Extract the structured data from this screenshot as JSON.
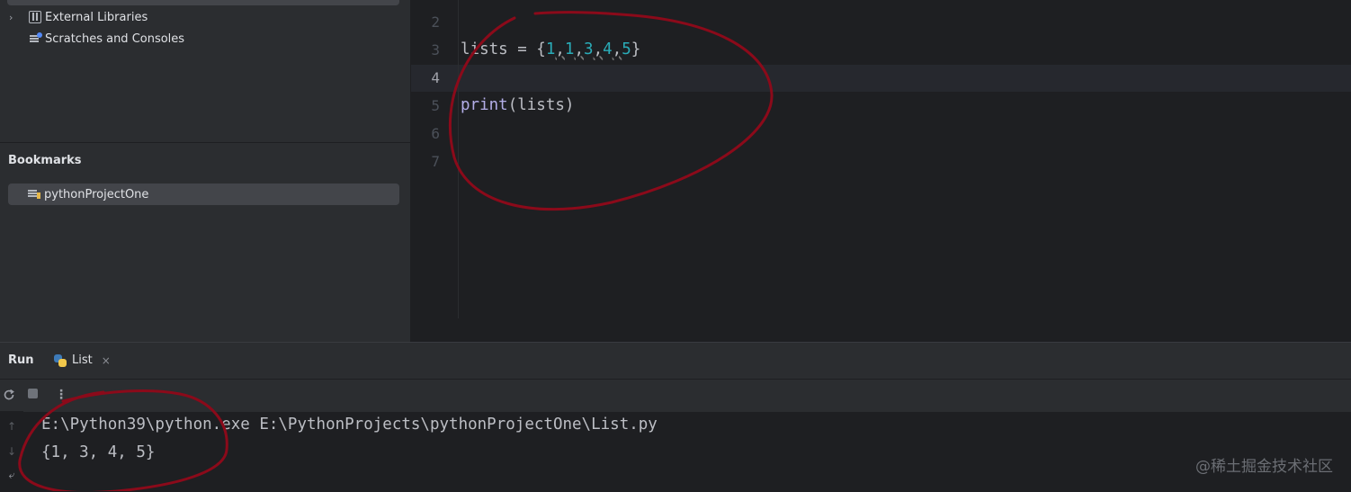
{
  "project_tree": {
    "items": [
      {
        "label": "External Libraries",
        "icon": "library-icon"
      },
      {
        "label": "Scratches and Consoles",
        "icon": "scratches-icon"
      }
    ]
  },
  "bookmarks": {
    "title": "Bookmarks",
    "items": [
      {
        "label": "pythonProjectOne"
      }
    ]
  },
  "editor": {
    "line_numbers": [
      "2",
      "3",
      "4",
      "5",
      "6",
      "7"
    ],
    "active_line": "4",
    "code_lines": {
      "line3_prefix": "lists = {",
      "line3_values": [
        "1",
        "1",
        "3",
        "4",
        "5"
      ],
      "line3_suffix": "}",
      "line5_fn": "print",
      "line5_args": "(lists)"
    }
  },
  "run_panel": {
    "title": "Run",
    "tab_label": "List",
    "tab_close": "×",
    "toolbar_more": "⋮",
    "console": {
      "command": "E:\\Python39\\python.exe E:\\PythonProjects\\pythonProjectOne\\List.py",
      "output": "{1, 3, 4, 5}"
    }
  },
  "watermark": "@稀土掘金技术社区",
  "colors": {
    "annotation": "#8b0a1a",
    "number": "#2aacb8",
    "function": "#b3aee8"
  }
}
